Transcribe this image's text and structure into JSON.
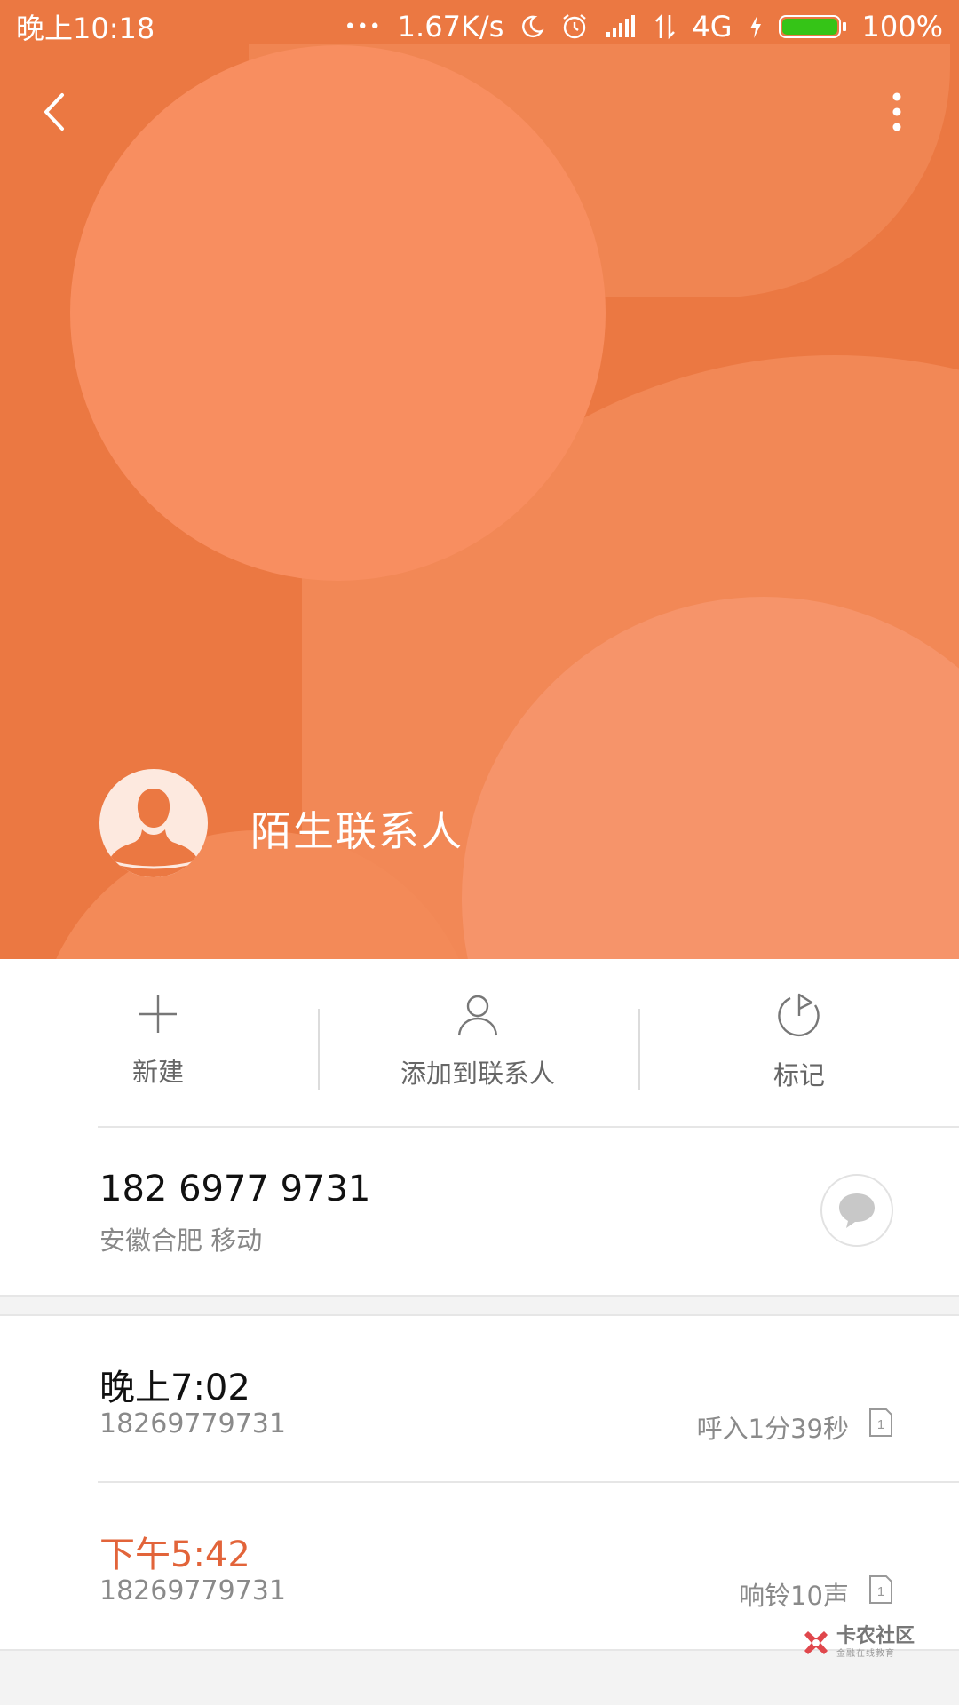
{
  "status_bar": {
    "time": "晚上10:18",
    "more_dots": "•••",
    "net_speed": "1.67K/s",
    "network": "4G",
    "battery_level": 1.0,
    "battery_text": "100%"
  },
  "header": {
    "contact_name": "陌生联系人",
    "back_icon": "chevron-left-icon",
    "more_icon": "more-vertical-icon",
    "avatar_icon": "person-silhouette-icon"
  },
  "actions": [
    {
      "label": "新建",
      "icon": "plus-icon"
    },
    {
      "label": "添加到联系人",
      "icon": "person-icon"
    },
    {
      "label": "标记",
      "icon": "flag-icon"
    }
  ],
  "number": {
    "display": "182 6977 9731",
    "location": "安徽合肥 移动",
    "sms_icon": "message-bubble-icon"
  },
  "calls": [
    {
      "time": "晚上7:02",
      "number": "18269779731",
      "status": "呼入1分39秒",
      "sim": "1",
      "missed": false
    },
    {
      "time": "下午5:42",
      "number": "18269779731",
      "status": "响铃10声",
      "sim": "1",
      "missed": true
    }
  ],
  "watermark": {
    "title": "卡农社区",
    "subtitle": "金融在线教育"
  },
  "colors": {
    "header_bg": "#eb7842",
    "missed_call": "#e2643a",
    "battery": "#35c417"
  }
}
